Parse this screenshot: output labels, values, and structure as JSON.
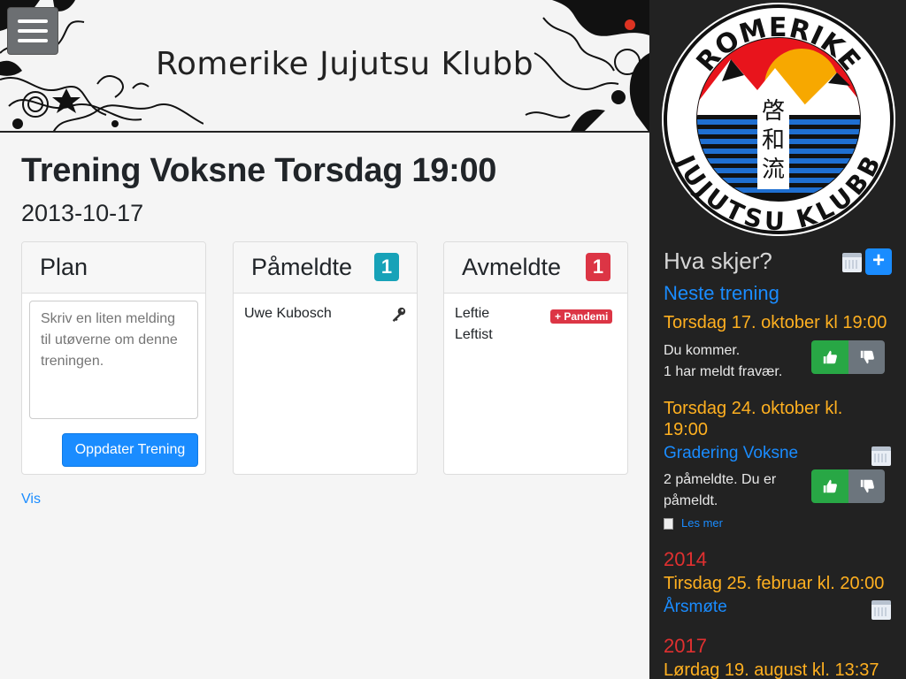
{
  "header": {
    "title": "Romerike Jujutsu Klubb",
    "menu_icon": "hamburger-icon"
  },
  "main": {
    "title": "Trening Voksne Torsdag 19:00",
    "date": "2013-10-17",
    "plan": {
      "title": "Plan",
      "placeholder": "Skriv en liten melding til utøverne om denne treningen.",
      "button": "Oppdater Trening"
    },
    "pameldte": {
      "title": "Påmeldte",
      "count": "1",
      "people": [
        {
          "name": "Uwe Kubosch",
          "icon": "key-icon"
        }
      ]
    },
    "avmeldte": {
      "title": "Avmeldte",
      "count": "1",
      "people": [
        {
          "name": "Leftie"
        },
        {
          "name": "Leftist"
        }
      ],
      "badge": "Pandemi"
    },
    "vis_link": "Vis"
  },
  "sidebar": {
    "logo_top_text": "ROMERIKE",
    "logo_bottom_text": "JUJUTSU KLUBB",
    "logo_kanji": [
      "啓",
      "和",
      "流"
    ],
    "heading": "Hva skjer?",
    "add_label": "+",
    "neste_trening": "Neste trening",
    "events": [
      {
        "date": "Torsdag 17. oktober kl 19:00",
        "status_line1": "Du kommer.",
        "status_line2": "1 har meldt fravær."
      },
      {
        "date_line1": "Torsdag 24. oktober kl.",
        "date_line2": "19:00",
        "title": "Gradering Voksne",
        "status_line1": "2 påmeldte. Du er",
        "status_line2": "påmeldt.",
        "les_mer": "Les mer"
      }
    ],
    "year_2014": "2014",
    "event_2014_date": "Tirsdag 25. februar kl. 20:00",
    "event_2014_title": "Årsmøte",
    "year_2017": "2017",
    "event_2017_date": "Lørdag 19. august kl. 13:37"
  },
  "colors": {
    "accent_blue": "#1a8cff",
    "orange": "#ffb020",
    "red": "#dc3545",
    "teal_badge": "#17a2b8",
    "green": "#28a745",
    "sidebar_bg": "#222222"
  }
}
